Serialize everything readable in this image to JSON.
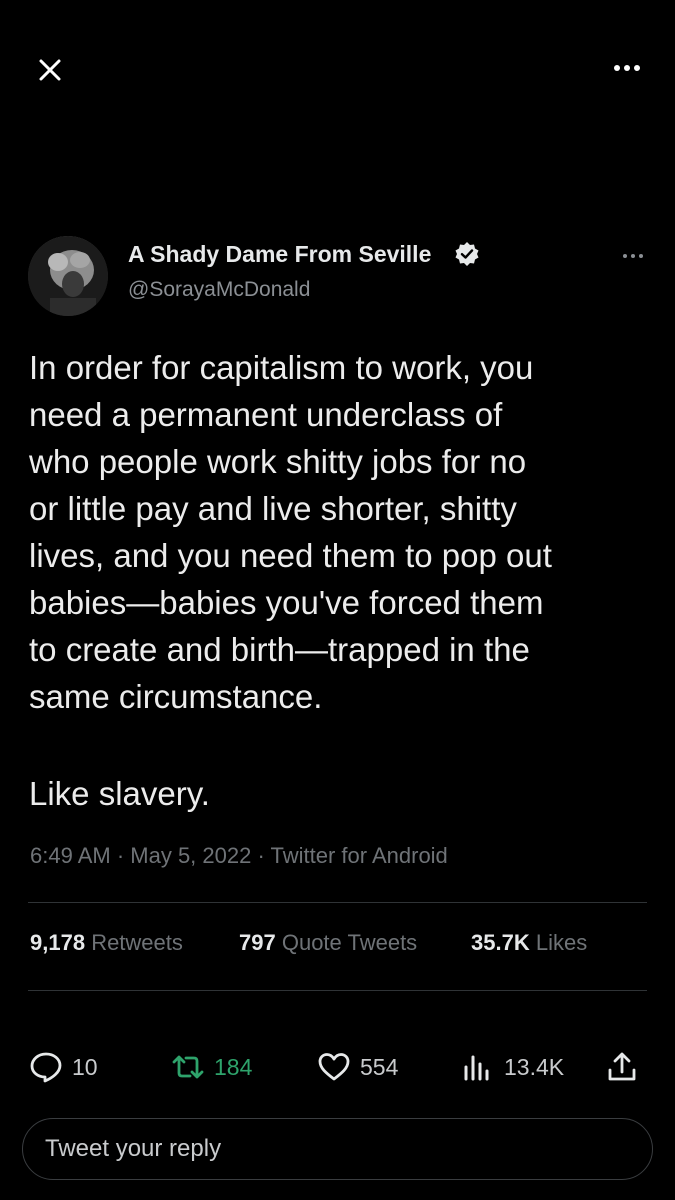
{
  "header": {
    "close_icon": "close-icon",
    "more_icon": "more-horizontal-icon"
  },
  "author": {
    "display_name": "A Shady Dame From Seville",
    "handle": "@SorayaMcDonald",
    "verified": true
  },
  "tweet": {
    "text": "In order for capitalism to work, you\nneed a permanent underclass of\nwho people work shitty jobs for no\nor little pay and live shorter, shitty\nlives, and you need them to pop out\nbabies—babies you've forced them\nto create and birth—trapped in the\nsame circumstance.",
    "text2": "Like slavery.",
    "meta": "6:49 AM · May 5, 2022 · Twitter for Android"
  },
  "stats": {
    "retweets_count": "9,178",
    "retweets_label": "Retweets",
    "quotes_count": "797",
    "quotes_label": "Quote Tweets",
    "likes_count": "35.7K",
    "likes_label": "Likes"
  },
  "actions": {
    "replies": "10",
    "retweets": "184",
    "likes": "554",
    "views": "13.4K"
  },
  "reply": {
    "placeholder": "Tweet your reply"
  },
  "colors": {
    "background": "#000000",
    "text": "#e7e9ea",
    "secondary": "#6f7377",
    "retweet_green": "#2ea36b"
  }
}
